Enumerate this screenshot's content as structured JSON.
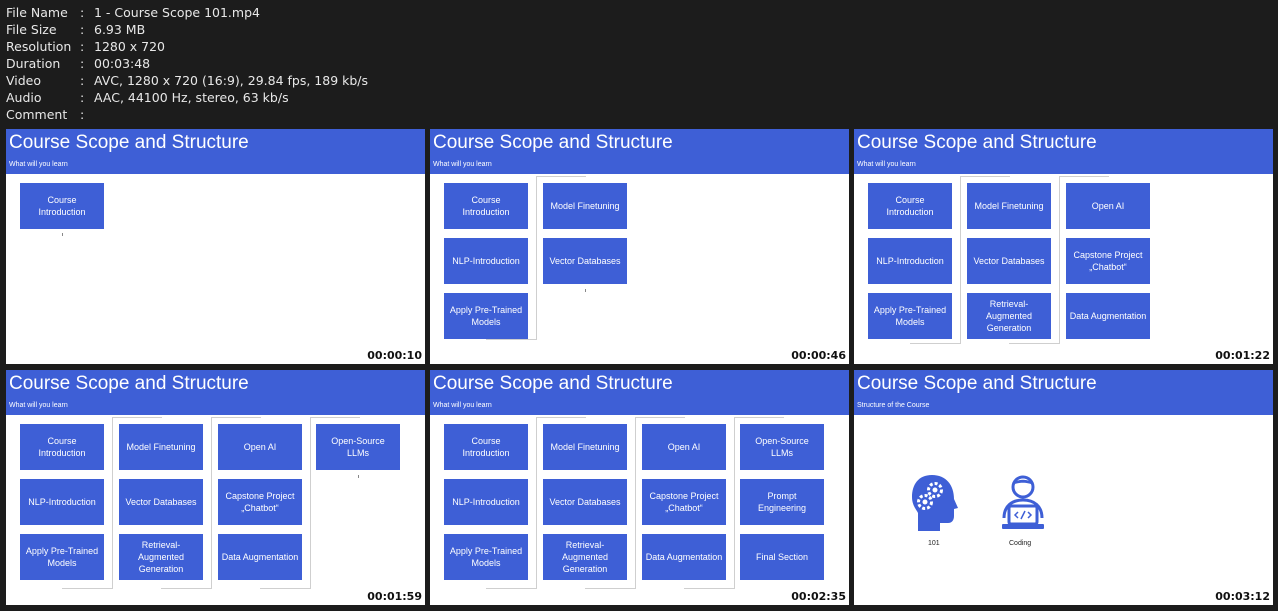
{
  "info": {
    "rows": [
      {
        "key": "File Name",
        "value": "1 - Course Scope 101.mp4"
      },
      {
        "key": "File Size",
        "value": "6.93 MB"
      },
      {
        "key": "Resolution",
        "value": "1280 x 720"
      },
      {
        "key": "Duration",
        "value": "00:03:48"
      },
      {
        "key": "Video",
        "value": "AVC, 1280 x 720 (16:9), 29.84 fps, 189 kb/s"
      },
      {
        "key": "Audio",
        "value": "AAC, 44100 Hz, stereo, 63 kb/s"
      },
      {
        "key": "Comment",
        "value": ""
      }
    ],
    "separator": ":"
  },
  "slide": {
    "title": "Course Scope and Structure",
    "subtitle_learn": "What will you learn",
    "subtitle_structure": "Structure of the Course"
  },
  "boxes": {
    "course_intro": "Course Introduction",
    "nlp_intro": "NLP-Introduction",
    "apply_pretrained": "Apply Pre-Trained Models",
    "model_finetuning": "Model Finetuning",
    "vector_db": "Vector Databases",
    "rag": "Retrieval-Augmented Generation",
    "open_ai": "Open AI",
    "capstone": "Capstone Project „Chatbot“",
    "data_aug": "Data Augmentation",
    "open_source": "Open-Source LLMs",
    "prompt_eng": "Prompt Engineering",
    "final_section": "Final Section"
  },
  "icons": {
    "label_101": "101",
    "label_coding": "Coding"
  },
  "timestamps": [
    "00:00:10",
    "00:00:46",
    "00:01:22",
    "00:01:59",
    "00:02:35",
    "00:03:12"
  ],
  "colors": {
    "slide_blue": "#3e5fd6"
  }
}
